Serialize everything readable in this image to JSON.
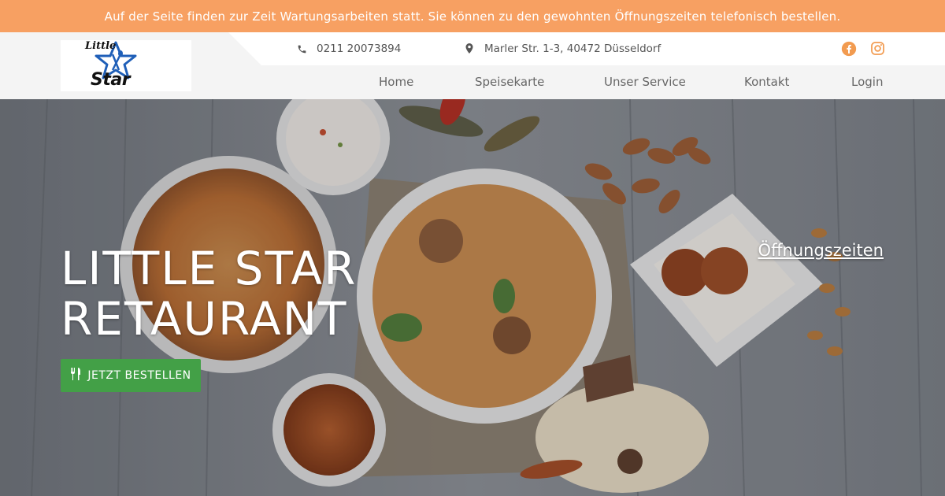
{
  "announcement": {
    "text": "Auf der Seite finden zur Zeit Wartungsarbeiten statt. Sie können zu den gewohnten Öffnungszeiten telefonisch bestellen."
  },
  "header": {
    "logo": {
      "line1": "Little",
      "line2": "Star"
    },
    "phone": "0211 20073894",
    "address": "Marler Str. 1-3, 40472 Düsseldorf",
    "social": [
      "facebook-icon",
      "instagram-icon"
    ]
  },
  "nav": {
    "items": [
      {
        "label": "Home"
      },
      {
        "label": "Speisekarte"
      },
      {
        "label": "Unser Service"
      },
      {
        "label": "Kontakt"
      },
      {
        "label": "Login"
      }
    ]
  },
  "hero": {
    "title_line1": "Little Star",
    "title_line2": "Retaurant",
    "order_button": "Jetzt bestellen",
    "hours_link": "Öffnungszeiten"
  },
  "colors": {
    "announcement_bg": "#f7a062",
    "accent_orange": "#f29b50",
    "button_green": "#43a047",
    "logo_blue": "#1f5fb8"
  }
}
